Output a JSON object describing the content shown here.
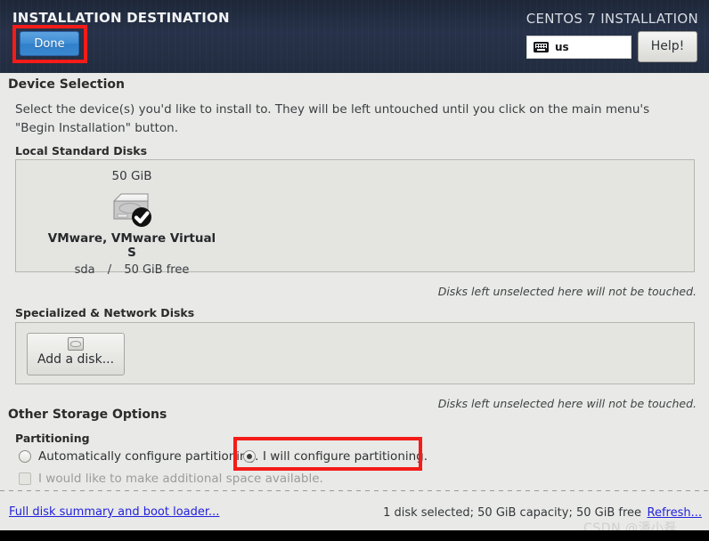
{
  "header": {
    "title": "INSTALLATION DESTINATION",
    "product_title": "CENTOS 7 INSTALLATION",
    "done_label": "Done",
    "help_label": "Help!",
    "keyboard_layout": "us",
    "keyboard_icon": "keyboard-icon",
    "annotation_color": "#f41c18",
    "accent_color": "#3f8ed4"
  },
  "device_selection": {
    "heading": "Device Selection",
    "description": "Select the device(s) you'd like to install to.  They will be left untouched until you click on the main menu's \"Begin Installation\" button.",
    "local_disks_heading": "Local Standard Disks",
    "local_disks": [
      {
        "capacity": "50 GiB",
        "icon": "hard-disk-selected-icon",
        "model": "VMware, VMware Virtual S",
        "device": "sda",
        "separator": "/",
        "free": "50 GiB free",
        "selected": true
      }
    ],
    "local_note": "Disks left unselected here will not be touched.",
    "specialized_heading": "Specialized & Network Disks",
    "add_disk_label": "Add a disk...",
    "add_disk_icon": "disk-add-icon",
    "specialized_note": "Disks left unselected here will not be touched."
  },
  "other_storage": {
    "heading": "Other Storage Options",
    "partitioning_heading": "Partitioning",
    "options": [
      {
        "label": "Automatically configure partitioning.",
        "selected": false,
        "type": "radio"
      },
      {
        "label": "I will configure partitioning.",
        "selected": true,
        "type": "radio",
        "highlighted": true
      }
    ],
    "extra_space": {
      "label": "I would like to make additional space available.",
      "checked": false,
      "disabled": true
    }
  },
  "footer": {
    "summary_link": "Full disk summary and boot loader...",
    "status": "1 disk selected; 50 GiB capacity; 50 GiB free",
    "refresh_link": "Refresh..."
  },
  "watermark": {
    "text": "CSDN @潘小磊"
  }
}
